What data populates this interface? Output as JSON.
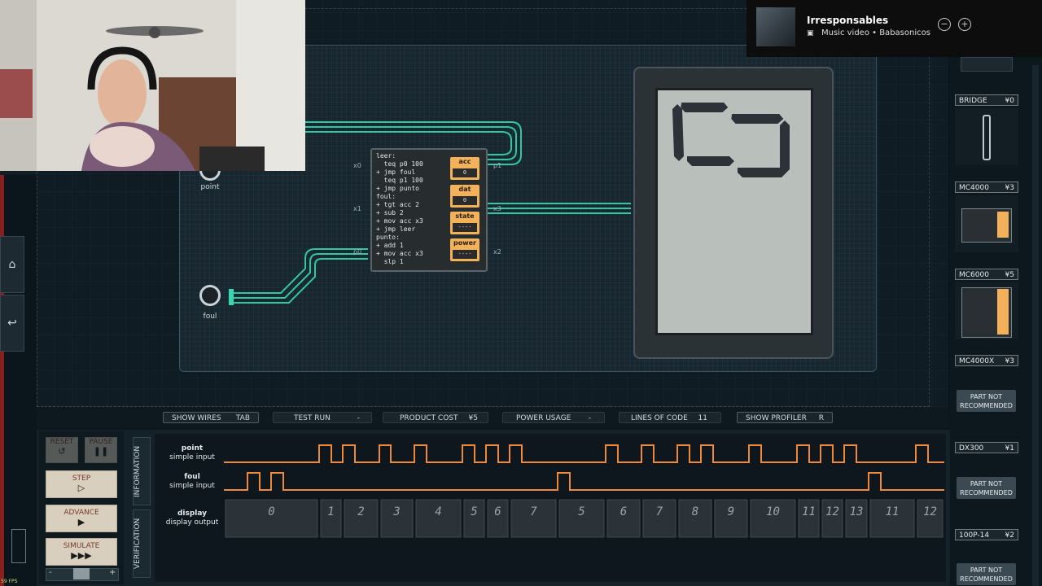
{
  "music": {
    "title": "Irresponsables",
    "subtitle": "Music video • Babasonicos"
  },
  "circuit": {
    "inputs": [
      {
        "label": "point"
      },
      {
        "label": "foul"
      }
    ],
    "mcu": {
      "code": "leer:\n  teq p0 100\n+ jmp foul\n  teq p1 100\n+ jmp punto\nfoul:\n+ tgt acc 2\n+ sub 2\n+ mov acc x3\n+ jmp leer\npunto:\n+ add 1\n+ mov acc x3\n  slp 1",
      "registers": [
        {
          "name": "acc",
          "value": "0"
        },
        {
          "name": "dat",
          "value": "0"
        },
        {
          "name": "state",
          "value": "----"
        },
        {
          "name": "power",
          "value": "----"
        }
      ],
      "pins": {
        "x0": "x0",
        "x1": "x1",
        "p0": "p0",
        "p1": "p1",
        "x3": "x3",
        "x2": "x2"
      }
    }
  },
  "parts": [
    {
      "name": "BRIDGE",
      "price": "¥0"
    },
    {
      "name": "MC4000",
      "price": "¥3"
    },
    {
      "name": "MC6000",
      "price": "¥5"
    },
    {
      "name": "MC4000X",
      "price": "¥3",
      "note": "PART NOT RECOMMENDED"
    },
    {
      "name": "DX300",
      "price": "¥1",
      "note": "PART NOT RECOMMENDED"
    },
    {
      "name": "100P-14",
      "price": "¥2",
      "note": "PART NOT RECOMMENDED"
    }
  ],
  "statusbar": {
    "show_wires": {
      "label": "SHOW WIRES",
      "key": "TAB"
    },
    "test_run": {
      "label": "TEST RUN",
      "value": "-"
    },
    "product_cost": {
      "label": "PRODUCT COST",
      "value": "¥5"
    },
    "power_usage": {
      "label": "POWER USAGE",
      "value": "-"
    },
    "lines_of_code": {
      "label": "LINES OF CODE",
      "value": "11"
    },
    "show_profiler": {
      "label": "SHOW PROFILER",
      "key": "R"
    }
  },
  "controls": {
    "reset": "RESET",
    "pause": "PAUSE",
    "step": "STEP",
    "advance": "ADVANCE",
    "simulate": "SIMULATE",
    "step_icon": "▷",
    "advance_icon": "▶",
    "simulate_icon": "▶▶▶"
  },
  "tabs": {
    "information": "INFORMATION",
    "verification": "VERIFICATION"
  },
  "signals": [
    {
      "name": "point",
      "type": "simple input"
    },
    {
      "name": "foul",
      "type": "simple input"
    },
    {
      "name": "display",
      "type": "display output"
    }
  ],
  "display_values": [
    "0",
    "1",
    "2",
    "3",
    "4",
    "5",
    "6",
    "7",
    "5",
    "6",
    "7",
    "8",
    "9",
    "10",
    "11",
    "12",
    "13",
    "11",
    "12"
  ],
  "fps": "59 FPS",
  "colors": {
    "wire": "#35d8b0",
    "accent": "#f3b15a",
    "trace": "#f08a3a"
  }
}
